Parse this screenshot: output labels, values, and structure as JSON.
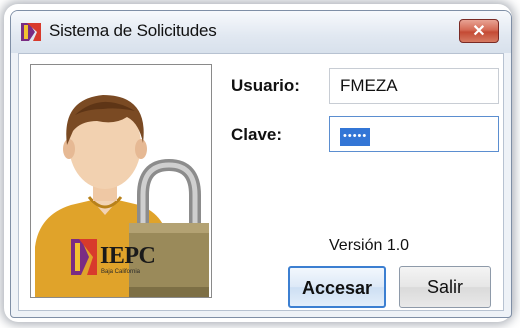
{
  "window": {
    "title": "Sistema de Solicitudes",
    "close_symbol": "✕",
    "icon": "iepc-app-icon"
  },
  "login": {
    "usuario_label": "Usuario:",
    "usuario_value": "FMEZA",
    "clave_label": "Clave:",
    "clave_masked": "•••••",
    "version": "Versión 1.0"
  },
  "illustration": {
    "icon": "user-lock-illustration",
    "badge_text": "IEPC",
    "badge_subtext": "Baja California"
  },
  "buttons": {
    "accept_label": "Accesar",
    "exit_label": "Salir"
  },
  "colors": {
    "accent": "#3c7fd1",
    "close": "#c44a34",
    "shirt": "#e0a32a",
    "lock": "#9a8a5a"
  }
}
